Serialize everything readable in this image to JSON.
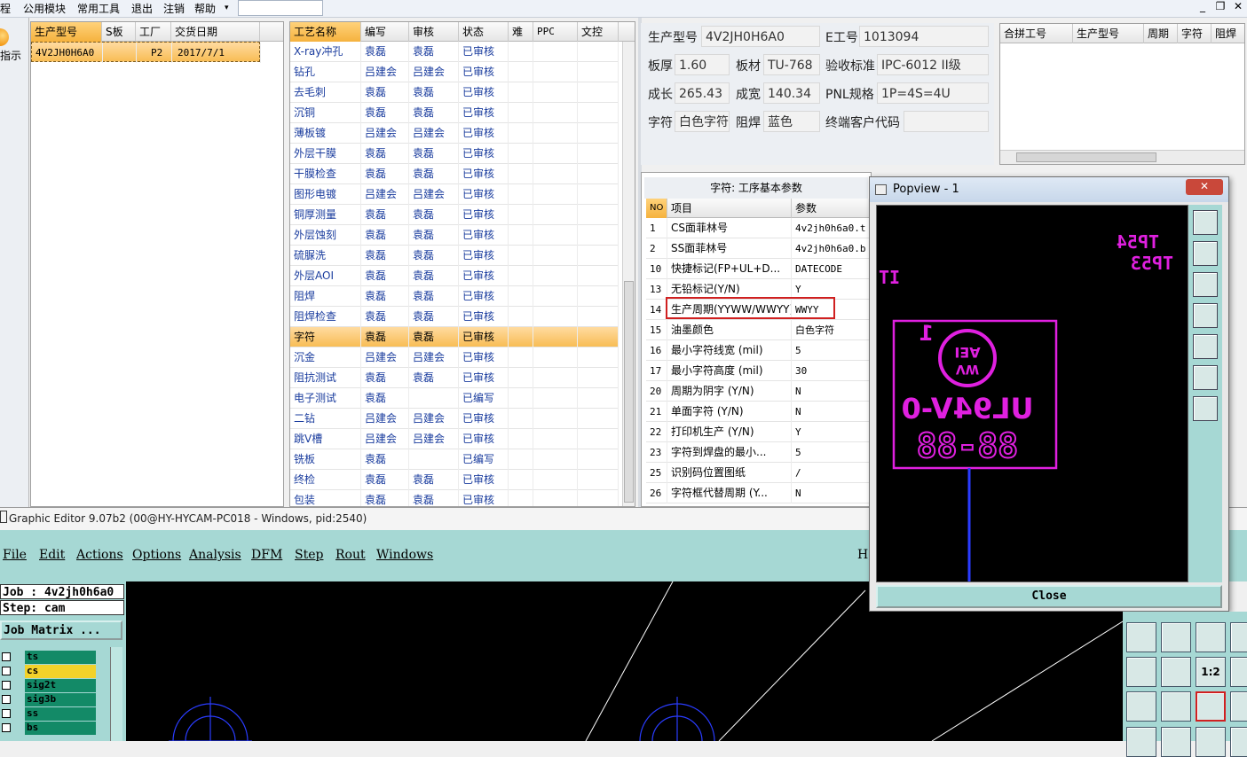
{
  "menubar": {
    "items": [
      "程",
      "公用模块",
      "常用工具",
      "退出",
      "注销",
      "帮助"
    ],
    "help_arrow": "▾",
    "window_controls": [
      "_",
      "❐",
      "✕"
    ]
  },
  "left_panel": {
    "indicator_label": "指示",
    "headers": [
      "生产型号",
      "S板",
      "工厂",
      "交货日期"
    ],
    "rows": [
      {
        "model": "4V2JH0H6A0",
        "s": "",
        "factory": "P2",
        "date": "2017/7/1"
      }
    ]
  },
  "process_grid": {
    "headers": [
      "工艺名称",
      "编写",
      "审核",
      "状态",
      "难",
      "PPC",
      "文控"
    ],
    "rows": [
      {
        "name": "X-ray冲孔",
        "writer": "袁磊",
        "reviewer": "袁磊",
        "status": "已审核"
      },
      {
        "name": "钻孔",
        "writer": "吕建会",
        "reviewer": "吕建会",
        "status": "已审核"
      },
      {
        "name": "去毛刺",
        "writer": "袁磊",
        "reviewer": "袁磊",
        "status": "已审核"
      },
      {
        "name": "沉铜",
        "writer": "袁磊",
        "reviewer": "袁磊",
        "status": "已审核"
      },
      {
        "name": "薄板镀",
        "writer": "吕建会",
        "reviewer": "吕建会",
        "status": "已审核"
      },
      {
        "name": "外层干膜",
        "writer": "袁磊",
        "reviewer": "袁磊",
        "status": "已审核"
      },
      {
        "name": "干膜检查",
        "writer": "袁磊",
        "reviewer": "袁磊",
        "status": "已审核"
      },
      {
        "name": "图形电镀",
        "writer": "吕建会",
        "reviewer": "吕建会",
        "status": "已审核"
      },
      {
        "name": "铜厚测量",
        "writer": "袁磊",
        "reviewer": "袁磊",
        "status": "已审核"
      },
      {
        "name": "外层蚀刻",
        "writer": "袁磊",
        "reviewer": "袁磊",
        "status": "已审核"
      },
      {
        "name": "硫脲洗",
        "writer": "袁磊",
        "reviewer": "袁磊",
        "status": "已审核"
      },
      {
        "name": "外层AOI",
        "writer": "袁磊",
        "reviewer": "袁磊",
        "status": "已审核"
      },
      {
        "name": "阻焊",
        "writer": "袁磊",
        "reviewer": "袁磊",
        "status": "已审核"
      },
      {
        "name": "阻焊检查",
        "writer": "袁磊",
        "reviewer": "袁磊",
        "status": "已审核"
      },
      {
        "name": "字符",
        "writer": "袁磊",
        "reviewer": "袁磊",
        "status": "已审核"
      },
      {
        "name": "沉金",
        "writer": "吕建会",
        "reviewer": "吕建会",
        "status": "已审核"
      },
      {
        "name": "阻抗测试",
        "writer": "袁磊",
        "reviewer": "袁磊",
        "status": "已审核"
      },
      {
        "name": "电子测试",
        "writer": "袁磊",
        "reviewer": "",
        "status": "已编写"
      },
      {
        "name": "二钻",
        "writer": "吕建会",
        "reviewer": "吕建会",
        "status": "已审核"
      },
      {
        "name": "跳V槽",
        "writer": "吕建会",
        "reviewer": "吕建会",
        "status": "已审核"
      },
      {
        "name": "铣板",
        "writer": "袁磊",
        "reviewer": "",
        "status": "已编写"
      },
      {
        "name": "终检",
        "writer": "袁磊",
        "reviewer": "袁磊",
        "status": "已审核"
      },
      {
        "name": "包装",
        "writer": "袁磊",
        "reviewer": "袁磊",
        "status": "已审核"
      }
    ]
  },
  "info": {
    "model_label": "生产型号",
    "model": "4V2JH0H6A0",
    "e_label": "E工号",
    "e_no": "1013094",
    "thick_label": "板厚",
    "thick": "1.60",
    "mat_label": "板材",
    "mat": "TU-768",
    "std_label": "验收标准",
    "std": "IPC-6012 II级",
    "len_label": "成长",
    "len": "265.43",
    "wid_label": "成宽",
    "wid": "140.34",
    "pnl_label": "PNL规格",
    "pnl": "1P=4S=4U",
    "char_label": "字符",
    "char": "白色字符",
    "mask_label": "阻焊",
    "mask": "蓝色",
    "cust_label": "终端客户代码",
    "cust": ""
  },
  "merge_grid": {
    "headers": [
      "合拼工号",
      "生产型号",
      "周期",
      "字符",
      "阻焊"
    ]
  },
  "params": {
    "title": "字符: 工序基本参数",
    "headers": [
      "NO",
      "项目",
      "参数"
    ],
    "rows": [
      {
        "no": "1",
        "item": "CS面菲林号",
        "val": "4v2jh0h6a0.t"
      },
      {
        "no": "2",
        "item": "SS面菲林号",
        "val": "4v2jh0h6a0.b"
      },
      {
        "no": "10",
        "item": "快捷标记(FP+UL+D...",
        "val": "DATECODE"
      },
      {
        "no": "13",
        "item": "无铅标记(Y/N)",
        "val": "Y"
      },
      {
        "no": "14",
        "item": "生产周期(YYWW/WWYY)",
        "val": "WWYY"
      },
      {
        "no": "15",
        "item": "油墨颜色",
        "val": "白色字符"
      },
      {
        "no": "16",
        "item": "最小字符线宽 (mil)",
        "val": "5"
      },
      {
        "no": "17",
        "item": "最小字符高度 (mil)",
        "val": "30"
      },
      {
        "no": "20",
        "item": "周期为阴字 (Y/N)",
        "val": "N"
      },
      {
        "no": "21",
        "item": "单面字符 (Y/N)",
        "val": "N"
      },
      {
        "no": "22",
        "item": "打印机生产 (Y/N)",
        "val": "Y"
      },
      {
        "no": "23",
        "item": "字符到焊盘的最小...",
        "val": "5"
      },
      {
        "no": "25",
        "item": "识别码位置图纸",
        "val": "/"
      },
      {
        "no": "26",
        "item": "字符框代替周期 (Y...",
        "val": "N"
      }
    ]
  },
  "graphic_editor": {
    "title": "Graphic Editor 9.07b2 (00@HY-HYCAM-PC018 - Windows, pid:2540)",
    "menu": [
      "File",
      "Edit",
      "Actions",
      "Options",
      "Analysis",
      "DFM",
      "Step",
      "Rout",
      "Windows"
    ],
    "menu_right": "H",
    "job": "Job : 4v2jh0h6a0",
    "step": "Step: cam",
    "matrix_btn": "Job Matrix ...",
    "layers": [
      "ts",
      "cs",
      "sig2t",
      "sig3b",
      "ss",
      "bs"
    ]
  },
  "popview": {
    "title": "Popview - 1",
    "close_label": "Close",
    "pcb_texts": {
      "tp54": "TP54",
      "tp53": "TP53",
      "ti": "TI",
      "one": "1",
      "logo_top": "AEI",
      "logo_bot": "WV",
      "ul": "UL94V-0",
      "date": "88-88"
    }
  },
  "colors": {
    "magenta": "#e020e0",
    "teal": "#a6d8d4",
    "orange_sel": "#f8bd55",
    "highlight_red": "#d02020"
  }
}
